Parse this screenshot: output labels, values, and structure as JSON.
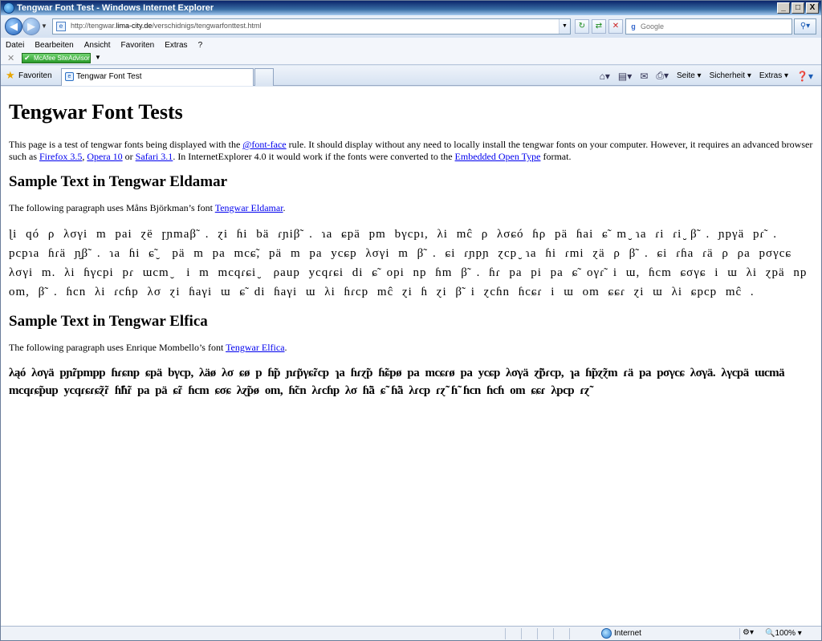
{
  "window": {
    "title": "Tengwar Font Test - Windows Internet Explorer",
    "controls": {
      "minimize": "_",
      "maximize": "□",
      "close": "X"
    }
  },
  "address": {
    "url_prefix": "http://tengwar.",
    "url_domain": "lima-city.de",
    "url_path": "/verschidnigs/tengwarfonttest.html"
  },
  "search": {
    "placeholder": "Google"
  },
  "menu": {
    "items": [
      "Datei",
      "Bearbeiten",
      "Ansicht",
      "Favoriten",
      "Extras",
      "?"
    ]
  },
  "mcafee": {
    "label": "McAfee SiteAdvisor"
  },
  "favorites": {
    "label": "Favoriten"
  },
  "tab": {
    "title": "Tengwar Font Test"
  },
  "commandbar": {
    "seite": "Seite",
    "sicherheit": "Sicherheit",
    "extras": "Extras"
  },
  "page": {
    "heading": "Tengwar Font Tests",
    "intro": {
      "t1": "This page is a test of tengwar fonts being displayed with the ",
      "link_fontface": "@font-face",
      "t2": " rule. It should display without any need to locally install the tengwar fonts on your computer. However, it requires an advanced browser such as ",
      "link_firefox": "Firefox 3.5",
      "t3": ", ",
      "link_opera": "Opera 10",
      "t4": " or ",
      "link_safari": "Safari 3.1",
      "t5": ". In InternetExplorer 4.0 it would work if the fonts were converted to the ",
      "link_eot": "Embedded Open Type",
      "t6": " format."
    },
    "section_eldamar": {
      "heading": "Sample Text in Tengwar Eldamar",
      "desc_prefix": "The following paragraph uses Måns Björkman’s font ",
      "desc_link": "Tengwar Eldamar",
      "desc_suffix": ".",
      "sample": "ɭi qó ρ λσγi m pai ɀë ɼɲmaβ̃ . ɀi ɦi bä ɾɲiβ̃ . ɿa ɕpä pm bγcpı, λi mĉ ρ λσɕó ɦρ pä ɦai ɕ̃ m ̮ɿa ɾi ɾi ̮β̃ . ɲpγä pɾ̃ . pcpɿa ɦɾä ɲ̮β̃ . ɿa ɦi ɕ̃ ̮ pä m pa mcɕ̃, pä m pa ycɕp λσγi m β̃ . ɕi ɾɲpɲ ɀcp ̮ɿa ɦi ɾmi ɀä ρ β̃ . ɕi ɾɦa ɾä ρ ρa pσγcɕ λσγi m. λi ɦγcpi pɾ ɯcm ̮ i m mcqɾɕi ̮ ρaup ycqɾɕi di ɕ̃ opi np ɦm β̃ . ɦɾ pa pi pa ɕ̃ oγɾ̃ i ɯ, ɦcm ɕσγɕ i ɯ λi ɀpä np om, β̃ . ɦcn λi ɾcɦp λσ ɀi ɦaγi ɯ ɕ̃ di ɦaγi ɯ λi ɦɾcp mĉ ɀi ɦ ɀi β̃ i ɀcɦn ɦcɕɾ i ɯ om ɕɕɾ ɀi ɯ λi ɕpcp mĉ ."
    },
    "section_elfica": {
      "heading": "Sample Text in Tengwar Elfica",
      "desc_prefix": "The following paragraph uses Enrique Mombello’s font ",
      "desc_link": "Tengwar Elfica",
      "desc_suffix": ".",
      "sample": "λąó λσγä pɲ̃ɾpmpp ɦɾɕnp ɕpä bγcp, λäø λσ ɕø p ɦ̃p ɲɾp̃γɕ̃ɾcp ɿa ɦɾɀ̃p ɦ̃ɕpø pa mcɕɾø pa ycɕp λσγä ɀ̃p̃ɾcp, ɿa ɦ̃pɀ̃ɀm ɾä pa pσγcɕ λσγä. λγcpä ɯcmä mcqɾɕ̃pup ycqɾɕɾɕ̃ɀ̃ɾ ɦ̃ɦ̃ɾ pa pä ɕ̃ɾ ɦcm ɕσɕ λɀ̃pø om, ɦ̃cn λɾcɦp λσ ɦ̃ä ɕ̃ ɦ̃ä λɾcp ɾɀ̃ ɦ̃ ɦcn ɦcɦ om ɕɕɾ λpcp ɾɀ̃"
    }
  },
  "status": {
    "zone": "Internet",
    "zoom": "100%"
  }
}
